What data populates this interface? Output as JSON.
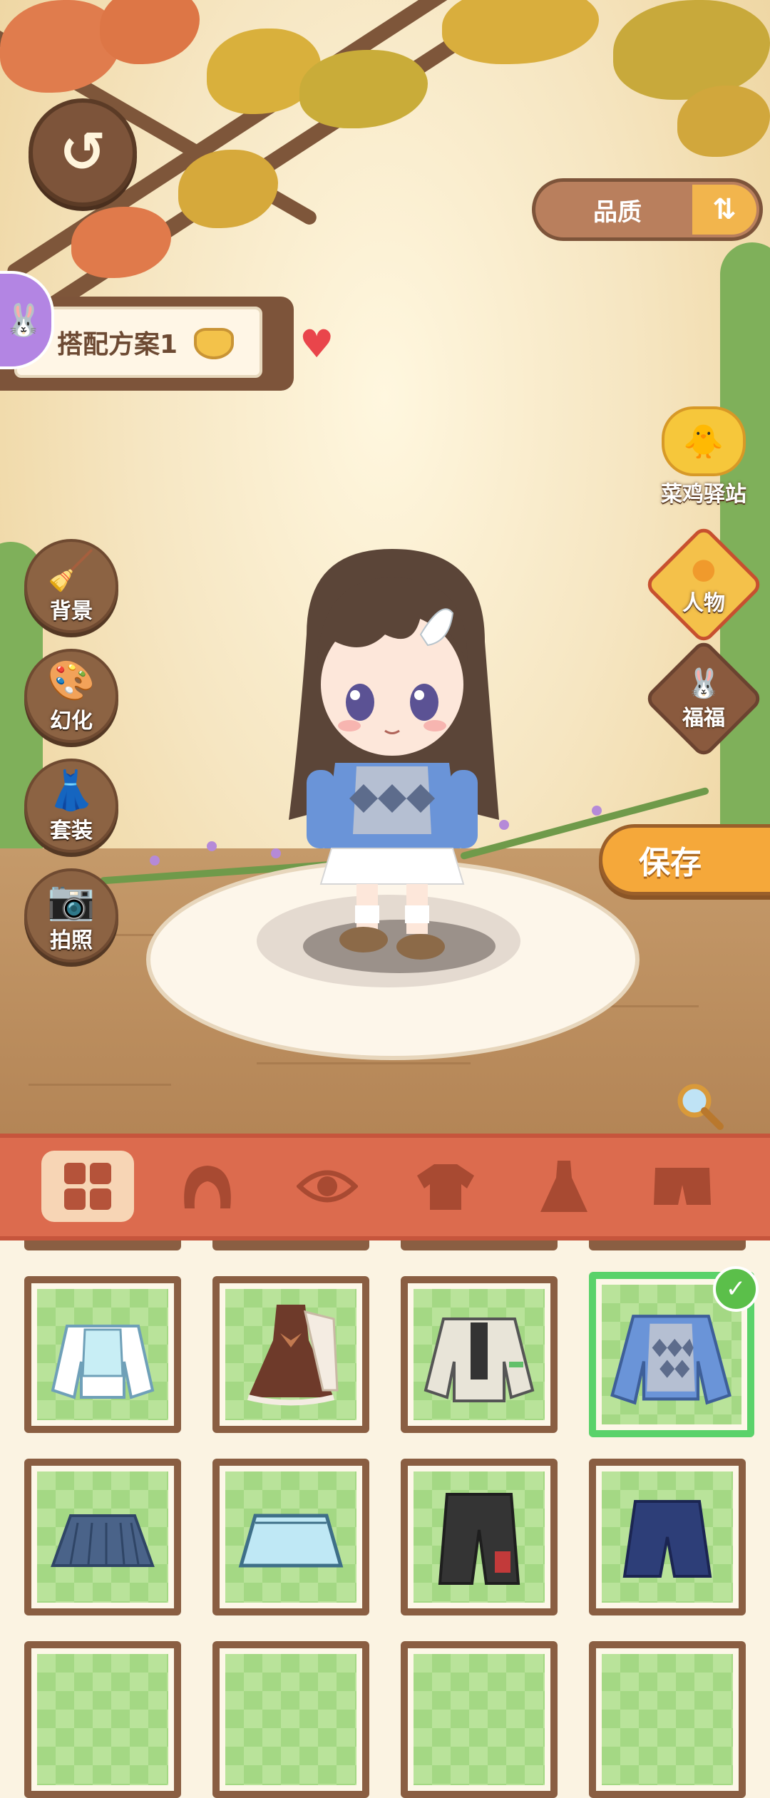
{
  "header": {
    "back_icon": "back-arrow-icon",
    "quality_label": "品质",
    "quality_sort_icon": "sort-icon"
  },
  "outfit_plan": {
    "name": "搭配方案1",
    "favorite_icon": "heart-icon"
  },
  "left_menu": [
    {
      "label": "背景",
      "icon": "broom-icon"
    },
    {
      "label": "幻化",
      "icon": "palette-icon"
    },
    {
      "label": "套装",
      "icon": "dress-hanger-icon"
    },
    {
      "label": "拍照",
      "icon": "camera-icon"
    }
  ],
  "right_menu": [
    {
      "label": "菜鸡驿站",
      "icon": "chick-station-icon"
    },
    {
      "label": "人物",
      "icon": "person-icon"
    },
    {
      "label": "福福",
      "icon": "bunny-icon"
    }
  ],
  "save_label": "保存",
  "category_tabs": [
    {
      "name": "all",
      "icon": "grid-icon",
      "active": true
    },
    {
      "name": "hair",
      "icon": "hair-icon",
      "active": false
    },
    {
      "name": "eyes",
      "icon": "eye-icon",
      "active": false
    },
    {
      "name": "tops",
      "icon": "shirt-icon",
      "active": false
    },
    {
      "name": "dresses",
      "icon": "dress-icon",
      "active": false
    },
    {
      "name": "bottoms",
      "icon": "shorts-icon",
      "active": false
    }
  ],
  "wardrobe_items": [
    {
      "item": "light-blue-vest-shirt",
      "selected": false
    },
    {
      "item": "brown-bow-dress",
      "selected": false
    },
    {
      "item": "white-utility-jacket",
      "selected": false
    },
    {
      "item": "blue-argyle-vest-shirt",
      "selected": true
    },
    {
      "item": "navy-pleated-skirt",
      "selected": false
    },
    {
      "item": "light-blue-skirt",
      "selected": false
    },
    {
      "item": "black-cargo-shorts",
      "selected": false
    },
    {
      "item": "navy-shorts",
      "selected": false
    }
  ],
  "colors": {
    "tab_bar": "#dc6b4e",
    "save_button": "#f5a83a",
    "selected_border": "#5ad26a",
    "frame_brown": "#8a5e42"
  }
}
